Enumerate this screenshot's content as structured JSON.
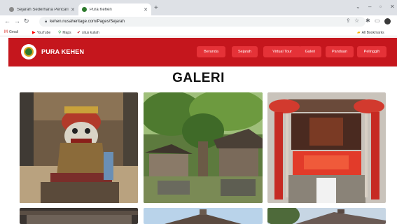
{
  "browser": {
    "tabs": [
      {
        "title": "Sejarah Sederhana Pencarian",
        "active": false
      },
      {
        "title": "Pura Kehen",
        "active": true
      }
    ],
    "url": "kehen.nusaheritage.com/Pages/Sejarah",
    "bookmarks": [
      "Gmail",
      "YouTube",
      "Maps",
      "situs kuliah"
    ],
    "all_bookmarks_label": "All Bookmarks"
  },
  "site": {
    "brand": "PURA KEHEN",
    "nav": [
      "Beranda",
      "Sejarah",
      "Virtual Tour",
      "Galeri",
      "Panduan",
      "Pelinggih"
    ],
    "colors": {
      "header": "#c5161d",
      "nav_button": "#e53238"
    }
  },
  "main": {
    "title": "GALERI",
    "photos": [
      {
        "subject": "barong-statue"
      },
      {
        "subject": "tropical-garden-shrines"
      },
      {
        "subject": "red-ornate-shrine"
      },
      {
        "subject": "temple-building"
      },
      {
        "subject": "pagoda-roof"
      },
      {
        "subject": "tiled-roof-tree"
      }
    ]
  }
}
